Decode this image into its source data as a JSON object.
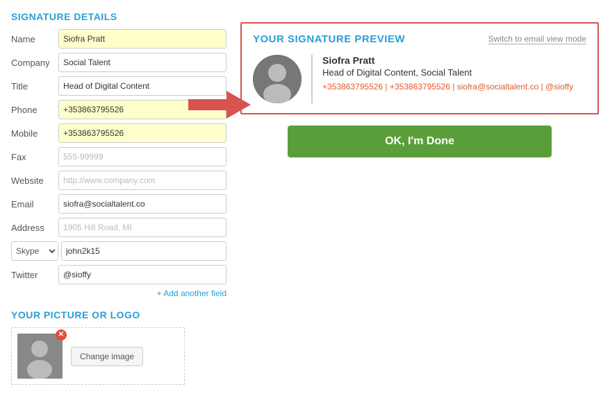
{
  "leftPanel": {
    "sectionTitle": "SIGNATURE DETAILS",
    "fields": [
      {
        "label": "Name",
        "value": "Siofra Pratt",
        "placeholder": "",
        "highlight": true,
        "type": "text"
      },
      {
        "label": "Company",
        "value": "Social Talent",
        "placeholder": "",
        "highlight": false,
        "type": "text"
      },
      {
        "label": "Title",
        "value": "Head of Digital Content",
        "placeholder": "",
        "highlight": false,
        "type": "text"
      },
      {
        "label": "Phone",
        "value": "+353863795526",
        "placeholder": "",
        "highlight": true,
        "type": "text"
      },
      {
        "label": "Mobile",
        "value": "+353863795526",
        "placeholder": "",
        "highlight": true,
        "type": "text"
      },
      {
        "label": "Fax",
        "value": "",
        "placeholder": "555-99999",
        "highlight": false,
        "type": "text"
      },
      {
        "label": "Website",
        "value": "",
        "placeholder": "http://www.company.com",
        "highlight": false,
        "type": "text"
      },
      {
        "label": "Email",
        "value": "siofra@socialtalent.co",
        "placeholder": "",
        "highlight": false,
        "type": "text"
      },
      {
        "label": "Address",
        "value": "",
        "placeholder": "1905 Hill Road, MI",
        "highlight": false,
        "type": "text"
      }
    ],
    "skypeField": {
      "selectValue": "Skype",
      "inputValue": "john2k15",
      "placeholder": ""
    },
    "twitterField": {
      "label": "Twitter",
      "value": "@sioffy",
      "placeholder": ""
    },
    "addFieldLink": "+ Add another field",
    "pictureSectionTitle": "YOUR PICTURE OR LOGO",
    "changeImageLabel": "Change image"
  },
  "rightPanel": {
    "previewTitle": "YOUR SIGNATURE PREVIEW",
    "switchModeLabel": "Switch to email view mode",
    "preview": {
      "name": "Siofra Pratt",
      "titleCompany": "Head of Digital Content, Social Talent",
      "contact": "+353863795526 | +353863795526 | siofra@socialtalent.co | @sioffy"
    },
    "okButton": "OK, I'm Done"
  }
}
